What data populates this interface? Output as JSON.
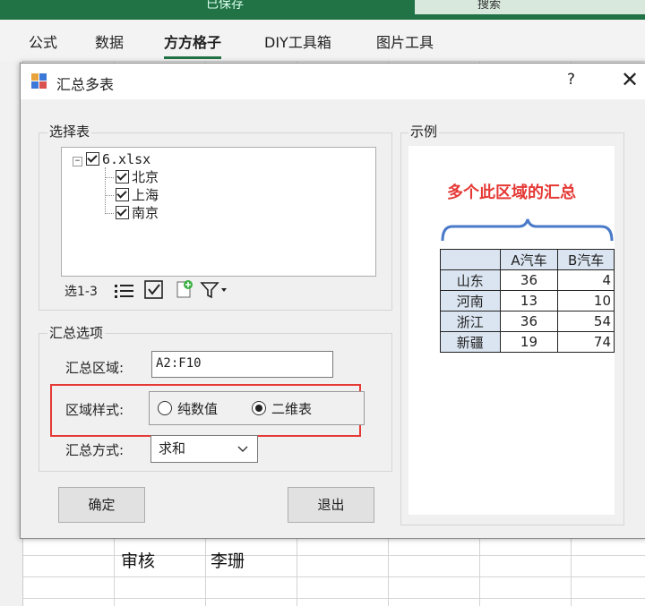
{
  "excel": {
    "window_title": "已保存",
    "search_label": "搜索",
    "ribbon_tabs": [
      {
        "label": "公式"
      },
      {
        "label": "数据"
      },
      {
        "label": "方方格子",
        "active": true
      },
      {
        "label": "DIY工具箱"
      },
      {
        "label": "图片工具"
      }
    ],
    "cells": {
      "reviewer_label": "审核",
      "reviewer_name": "李珊"
    }
  },
  "dialog": {
    "title": "汇总多表",
    "help": "?",
    "close": "✕",
    "select_group": {
      "label": "选择表",
      "file": "6.xlsx",
      "sheets": [
        "北京",
        "上海",
        "南京"
      ],
      "selection_text": "选1-3"
    },
    "options_group": {
      "label": "汇总选项",
      "range_label": "汇总区域:",
      "range_value": "A2:F10",
      "style_label": "区域样式:",
      "style_options": [
        {
          "label": "纯数值",
          "selected": false
        },
        {
          "label": "二维表",
          "selected": true
        }
      ],
      "method_label": "汇总方式:",
      "method_value": "求和"
    },
    "buttons": {
      "ok": "确定",
      "exit": "退出"
    },
    "example": {
      "label": "示例",
      "caption": "多个此区域的汇总",
      "header": [
        "",
        "A汽车",
        "B汽车"
      ],
      "rows": [
        [
          "山东",
          "36",
          "4"
        ],
        [
          "河南",
          "13",
          "10"
        ],
        [
          "浙江",
          "36",
          "54"
        ],
        [
          "新疆",
          "19",
          "74"
        ]
      ]
    }
  },
  "colors": {
    "excel_green": "#217346",
    "highlight_red": "#e53935",
    "caption_red": "#e53935",
    "brace_blue": "#4a7ac8"
  }
}
